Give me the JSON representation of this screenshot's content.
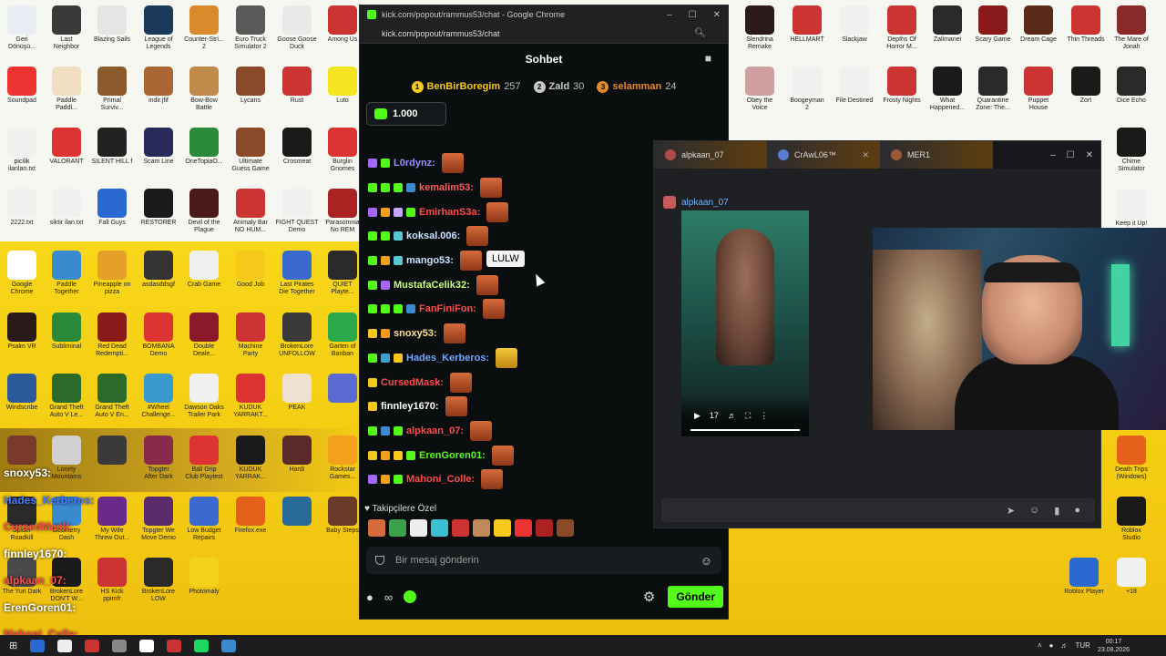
{
  "desktop": {
    "icons_left": [
      {
        "label": "Geri\nDönüşü...",
        "color": "#e8eef4",
        "x": 0
      },
      {
        "label": "Last\nNeighbor",
        "color": "#3a3a3a"
      },
      {
        "label": "Blazing Sails",
        "color": "#e5e5e5"
      },
      {
        "label": "League of\nLegends",
        "color": "#1a3a5a"
      },
      {
        "label": "Counter-Stri...\n2",
        "color": "#d98a2a"
      },
      {
        "label": "Euro Truck\nSimulator 2",
        "color": "#5a5a5a"
      },
      {
        "label": "Goose Goose\nDuck",
        "color": "#e9e9e9"
      },
      {
        "label": "Among Us",
        "color": "#c33"
      },
      {
        "label": "Soundpad",
        "color": "#e33"
      },
      {
        "label": "Paddle\nPaddl...",
        "color": "#f0e0c0"
      },
      {
        "label": "Primal\nSurviv...",
        "color": "#8a5a2a"
      },
      {
        "label": "indir.jfif",
        "color": "#aa6633"
      },
      {
        "label": "Bow-Bow\nBattle",
        "color": "#c08a4a"
      },
      {
        "label": "Lycans",
        "color": "#8a4a2a"
      },
      {
        "label": "Rust",
        "color": "#c33"
      },
      {
        "label": "Luto",
        "color": "#f5e520"
      },
      {
        "label": "picilik\nilanları.txt",
        "color": "#f0f0f0"
      },
      {
        "label": "VALORANT",
        "color": "#d33"
      },
      {
        "label": "SILENT HILL f",
        "color": "#222"
      },
      {
        "label": "Scam Line",
        "color": "#2a2a5a"
      },
      {
        "label": "OneTopiaO...",
        "color": "#2a8a3a"
      },
      {
        "label": "Ultimate\nGuess Game",
        "color": "#8a4a2a"
      },
      {
        "label": "Crosmeat",
        "color": "#1a1a1a"
      },
      {
        "label": "Burglin\nGnomes",
        "color": "#d33"
      },
      {
        "label": "2222.txt",
        "color": "#f0f0f0"
      },
      {
        "label": "siktir ilan.txt",
        "color": "#f0f0f0"
      },
      {
        "label": "Fall Guys",
        "color": "#2a6ad0"
      },
      {
        "label": "RESTORER",
        "color": "#1a1a1a"
      },
      {
        "label": "Devil of the\nPlague",
        "color": "#4a1a1a"
      },
      {
        "label": "Animaly Bar\nNO HUM...",
        "color": "#c33"
      },
      {
        "label": "FIGHT QUEST\nDemo",
        "color": "#f0f0f0"
      },
      {
        "label": "Parasomnia\nNo REM",
        "color": "#a22"
      },
      {
        "label": "Google\nChrome",
        "color": "#fff"
      },
      {
        "label": "Paddle\nTogether",
        "color": "#3a8ad0"
      },
      {
        "label": "Pineapple on\npizza",
        "color": "#e5a02a"
      },
      {
        "label": "asdasddsgf",
        "color": "#333"
      },
      {
        "label": "Crab Game",
        "color": "#f0f0f0"
      },
      {
        "label": "Good Job",
        "color": "#f5c81a"
      },
      {
        "label": "Last Pirates\nDie Together",
        "color": "#3a6ad0"
      },
      {
        "label": "QUIET\nPlayte...",
        "color": "#2a2a2a"
      },
      {
        "label": "Psalm VR",
        "color": "#2a1a1a"
      },
      {
        "label": "Subliminal",
        "color": "#2a8a3a"
      },
      {
        "label": "Red Dead\nRedempti...",
        "color": "#8a1a1a"
      },
      {
        "label": "BOMBANA\nDemo",
        "color": "#d33"
      },
      {
        "label": "Double\nDeale...",
        "color": "#8a1a2a"
      },
      {
        "label": "Machine\nParty",
        "color": "#c33"
      },
      {
        "label": "BrokenLore\nUNFOLLOW",
        "color": "#3a3a3a"
      },
      {
        "label": "Garten of\nBanban",
        "color": "#2aaa4a"
      },
      {
        "label": "Windscribe",
        "color": "#2a5a9a"
      },
      {
        "label": "Grand Theft\nAuto V Le...",
        "color": "#2a6a2a"
      },
      {
        "label": "Grand Theft\nAuto V En...",
        "color": "#2a6a2a"
      },
      {
        "label": "#Wheel\nChallenge...",
        "color": "#3a9ad0"
      },
      {
        "label": "Dawson Oaks\nTrailer Park",
        "color": "#f0f0f0"
      },
      {
        "label": "KUDUK\nYARRAKT...",
        "color": "#d33"
      },
      {
        "label": "PEAK",
        "color": "#f0e0d0"
      },
      {
        "label": "",
        "color": "#5a6ad0"
      },
      {
        "label": "",
        "color": "#7a3a2a"
      },
      {
        "label": "Lonely\nMountains",
        "color": "#d0d0d0"
      },
      {
        "label": "",
        "color": "#3a3a3a"
      },
      {
        "label": "Topgter\nAfter Dark",
        "color": "#8a2a4a"
      },
      {
        "label": "Ball Grip\nClub Playtest",
        "color": "#d33"
      },
      {
        "label": "KUDUK\nYARRAK...",
        "color": "#1a1a1a"
      },
      {
        "label": "Hardi",
        "color": "#5a2a2a"
      },
      {
        "label": "Rockstar\nGames...",
        "color": "#f5a01a"
      },
      {
        "label": "Spider\nRoadkill",
        "color": "#2a2a2a"
      },
      {
        "label": "Geometry\nDash",
        "color": "#3a8ad0"
      },
      {
        "label": "My Wife\nThrew Out...",
        "color": "#6a2a8a"
      },
      {
        "label": "Topgter We\nMove Demo",
        "color": "#5a2a6a"
      },
      {
        "label": "Low Budget\nRepairs",
        "color": "#3a6ad0"
      },
      {
        "label": "Firefox.exe",
        "color": "#e5601a"
      },
      {
        "label": "",
        "color": "#2a6a9a"
      },
      {
        "label": "Baby Steps",
        "color": "#6a3a2a"
      },
      {
        "label": "The Yuri Dark",
        "color": "#4a4a4a"
      },
      {
        "label": "BrokenLore\nDON'T W...",
        "color": "#1a1a1a"
      },
      {
        "label": "HS Kick\nppimfr",
        "color": "#c33"
      },
      {
        "label": "BrokenLore\nLOW",
        "color": "#2a2a2a"
      },
      {
        "label": "Photomaly",
        "color": "#f5d21a"
      }
    ],
    "icons_right": [
      {
        "label": "Slendrina\nRemake",
        "color": "#2a1a1a"
      },
      {
        "label": "HELLMART",
        "color": "#c33"
      },
      {
        "label": "Slackjaw",
        "color": "#f0f0f0"
      },
      {
        "label": "Depths Of\nHorror M...",
        "color": "#c33"
      },
      {
        "label": "Zalimanei",
        "color": "#2a2a2a"
      },
      {
        "label": "Scary Game",
        "color": "#8a1a1a"
      },
      {
        "label": "Dream Cage",
        "color": "#5a2a1a"
      },
      {
        "label": "Thin Threads",
        "color": "#c33"
      },
      {
        "label": "The Mare of\nJonah",
        "color": "#8a2a2a"
      },
      {
        "label": "Obey the\nVoice",
        "color": "#d0a0a0"
      },
      {
        "label": "Boogeyman\n2",
        "color": "#f0f0f0"
      },
      {
        "label": "File Destined",
        "color": "#f0f0f0"
      },
      {
        "label": "Frosty Nights",
        "color": "#c33"
      },
      {
        "label": "What\nHappened...",
        "color": "#1a1a1a"
      },
      {
        "label": "Quarantine\nZone: The...",
        "color": "#2a2a2a"
      },
      {
        "label": "Puppet\nHouse",
        "color": "#c33"
      },
      {
        "label": "Zort",
        "color": "#1a1a1a"
      },
      {
        "label": "Dice Echo",
        "color": "#2a2a2a"
      },
      {
        "label": "Chime\nSimulator",
        "color": "#1a1a1a"
      },
      {
        "label": "Keep it Up!\nReach",
        "color": "#f0f0f0"
      },
      {
        "label": "Death Trips\n(Windows)",
        "color": "#e5601a"
      },
      {
        "label": "Roblox\nStudio",
        "color": "#1a1a1a"
      },
      {
        "label": "Roblox Player",
        "color": "#2a6ad0"
      },
      {
        "label": "+18",
        "color": "#f0f0f0"
      }
    ]
  },
  "browser": {
    "window_title": "kick.com/popout/rammus53/chat - Google Chrome",
    "url": "kick.com/popout/rammus53/chat",
    "controls": [
      "–",
      "☐",
      "✕"
    ]
  },
  "chat": {
    "title": "Sohbet",
    "top_gifters": [
      {
        "rank": "1",
        "name": "BenBirBoregim",
        "count": "257",
        "color": "#f5c81a"
      },
      {
        "rank": "2",
        "name": "Zald",
        "count": "30",
        "color": "#c8c8c8"
      },
      {
        "rank": "3",
        "name": "selamman",
        "count": "24",
        "color": "#e08a2a"
      }
    ],
    "pinned_amount": "1.000",
    "messages": [
      {
        "user": "L0rdynz:",
        "color": "#9b8cff",
        "badges": [
          "#a468ff",
          "#53fc18"
        ]
      },
      {
        "user": "kemalim53:",
        "color": "#ff5a5a",
        "badges": [
          "#53fc18",
          "#53fc18",
          "#53fc18",
          "#3a8ad0"
        ]
      },
      {
        "user": "EmirhanS3a:",
        "color": "#ff4b4b",
        "badges": [
          "#a468ff",
          "#f5a01a",
          "#c4a8ff",
          "#53fc18"
        ]
      },
      {
        "user": "koksal.006:",
        "color": "#c8e2ff",
        "badges": [
          "#53fc18",
          "#53fc18",
          "#5ac8d0"
        ]
      },
      {
        "user": "mango53:",
        "color": "#c8e2ff",
        "badges": [
          "#53fc18",
          "#f5a01a",
          "#5ac8d0"
        ]
      },
      {
        "user": "MustafaCelik32:",
        "color": "#c4ff7a",
        "badges": [
          "#53fc18",
          "#a468ff"
        ]
      },
      {
        "user": "FanFiniFon:",
        "color": "#ff4b4b",
        "badges": [
          "#53fc18",
          "#53fc18",
          "#53fc18",
          "#3a8ad0"
        ]
      },
      {
        "user": "snoxy53:",
        "color": "#ffe08a",
        "badges": [
          "#f5c81a",
          "#f59a1a"
        ]
      },
      {
        "user": "Hades_Kerberos:",
        "color": "#6fa8ff",
        "badges": [
          "#53fc18",
          "#3aa0d0",
          "#f5c81a"
        ]
      },
      {
        "user": "CursedMask:",
        "color": "#ff4b4b",
        "badges": [
          "#f5c81a"
        ]
      },
      {
        "user": "finnley1670:",
        "color": "#ffffff",
        "badges": [
          "#f5c81a"
        ]
      },
      {
        "user": "alpkaan_07:",
        "color": "#ff4b4b",
        "badges": [
          "#53fc18",
          "#3a8ad0",
          "#53fc18"
        ]
      },
      {
        "user": "ErenGoren01:",
        "color": "#53fc18",
        "badges": [
          "#f5c81a",
          "#f5a01a",
          "#f5c81a",
          "#53fc18"
        ]
      },
      {
        "user": "Mahoni_Colle:",
        "color": "#ff4b4b",
        "badges": [
          "#a468ff",
          "#f5a01a",
          "#53fc18"
        ]
      }
    ],
    "tooltip": "LULW",
    "subscribers_only_label": "Takipçilere Özel",
    "input_placeholder": "Bir mesaj gönderin",
    "send_label": "Gönder"
  },
  "dm_window": {
    "tabs": [
      "alpkaan_07",
      "CrAwL06™",
      "MER1"
    ],
    "sender": "alpkaan_07",
    "video_time": "17"
  },
  "overlay_chat": [
    {
      "text": "snoxy53:",
      "cls": ""
    },
    {
      "text": "Hades_Kerberos:",
      "cls": "b"
    },
    {
      "text": "CursedMask:",
      "cls": "r"
    },
    {
      "text": "finnley1670:",
      "cls": ""
    },
    {
      "text": "alpkaan_07:",
      "cls": "r"
    },
    {
      "text": "ErenGoren01:",
      "cls": ""
    },
    {
      "text": "Mahoni_Colle:",
      "cls": "r"
    }
  ],
  "taskbar": {
    "lang": "TUR",
    "time": "00:17",
    "date": "23.08.2026",
    "apps": [
      "#2a6ad0",
      "#eee",
      "#c33",
      "#888",
      "#fff",
      "#c33",
      "#1ed760",
      "#3a8ad0"
    ]
  }
}
